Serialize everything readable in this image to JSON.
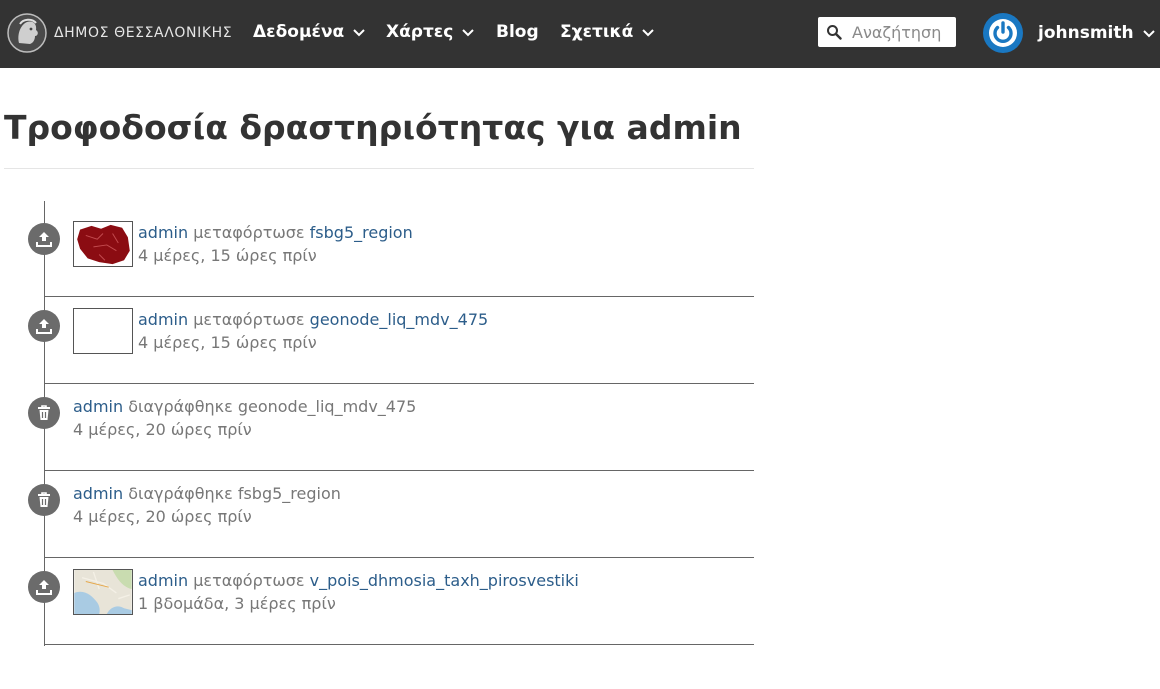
{
  "navbar": {
    "brand_text": "ΔΗΜΟΣ ΘΕΣΣΑΛΟΝΙΚΗΣ",
    "items": [
      {
        "label": "Δεδομένα",
        "has_dropdown": true
      },
      {
        "label": "Χάρτες",
        "has_dropdown": true
      },
      {
        "label": "Blog",
        "has_dropdown": false
      },
      {
        "label": "Σχετικά",
        "has_dropdown": true
      }
    ],
    "search": {
      "placeholder": "Αναζήτηση",
      "value": ""
    },
    "user": {
      "name": "johnsmith"
    }
  },
  "page": {
    "title": "Τροφοδοσία δραστηριότητας για admin"
  },
  "feed": [
    {
      "icon": "upload-icon",
      "actor": "admin",
      "verb": "μεταφόρτωσε",
      "object": "fsbg5_region",
      "object_is_link": true,
      "time": "4 μέρες, 15 ώρες πρίν",
      "thumbnail": "red-region-map"
    },
    {
      "icon": "upload-icon",
      "actor": "admin",
      "verb": "μεταφόρτωσε",
      "object": "geonode_liq_mdv_475",
      "object_is_link": true,
      "time": "4 μέρες, 15 ώρες πρίν",
      "thumbnail": "blank"
    },
    {
      "icon": "trash-icon",
      "actor": "admin",
      "verb": "διαγράφθηκε",
      "object": "geonode_liq_mdv_475",
      "object_is_link": false,
      "time": "4 μέρες, 20 ώρες πρίν",
      "thumbnail": ""
    },
    {
      "icon": "trash-icon",
      "actor": "admin",
      "verb": "διαγράφθηκε",
      "object": "fsbg5_region",
      "object_is_link": false,
      "time": "4 μέρες, 20 ώρες πρίν",
      "thumbnail": ""
    },
    {
      "icon": "upload-icon",
      "actor": "admin",
      "verb": "μεταφόρτωσε",
      "object": "v_pois_dhmosia_taxh_pirosvestiki",
      "object_is_link": true,
      "time": "1 βδομάδα, 3 μέρες πρίν",
      "thumbnail": "coastline-map"
    }
  ],
  "colors": {
    "navbar_bg": "#333333",
    "link": "#2c5d8a",
    "muted_text": "#777777",
    "icon_bg": "#6b6b6b",
    "avatar_blue": "#1a78c2"
  }
}
